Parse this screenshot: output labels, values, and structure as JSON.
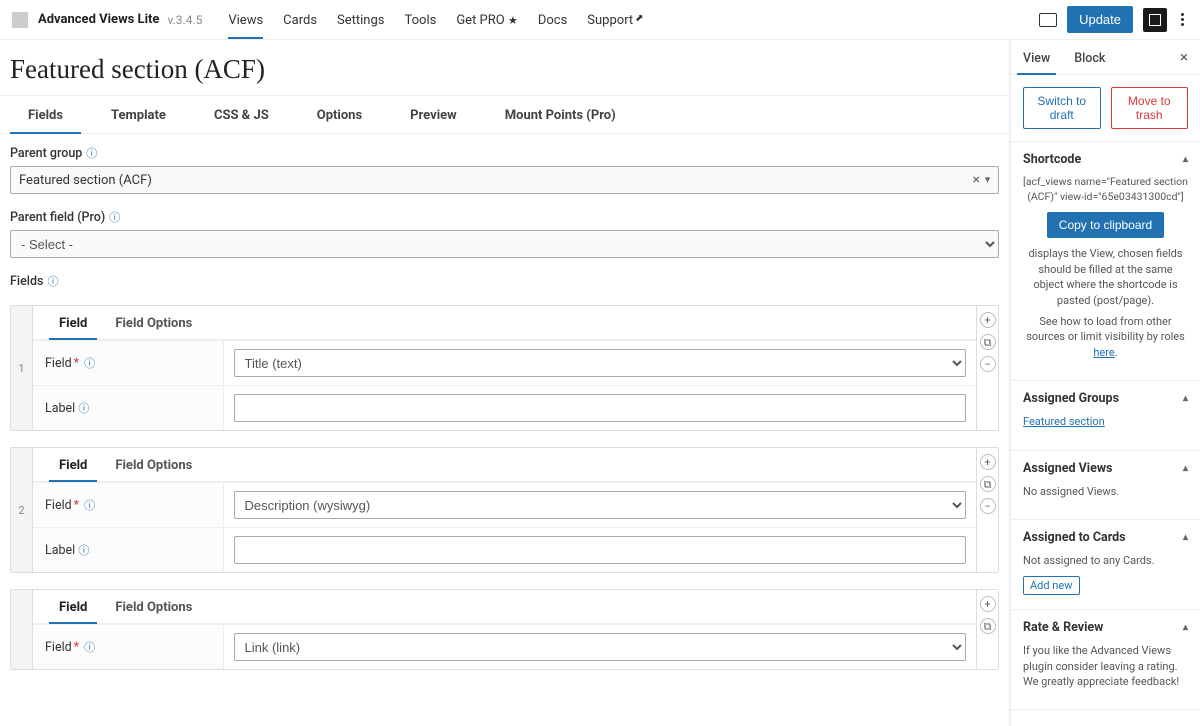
{
  "topbar": {
    "brand": "Advanced Views Lite",
    "version": "v.3.4.5",
    "nav": {
      "views": "Views",
      "cards": "Cards",
      "settings": "Settings",
      "tools": "Tools",
      "getpro": "Get PRO",
      "docs": "Docs",
      "support": "Support"
    },
    "update": "Update"
  },
  "page": {
    "title": "Featured section (ACF)"
  },
  "tabs": {
    "fields": "Fields",
    "template": "Template",
    "cssjs": "CSS & JS",
    "options": "Options",
    "preview": "Preview",
    "mount": "Mount Points (Pro)"
  },
  "pg": {
    "label": "Parent group",
    "value": "Featured section (ACF)"
  },
  "pf": {
    "label": "Parent field (Pro)",
    "value": "- Select -"
  },
  "flds": {
    "label": "Fields"
  },
  "rowtabs": {
    "field": "Field",
    "opts": "Field Options"
  },
  "rowlabels": {
    "field": "Field",
    "label": "Label"
  },
  "rows": {
    "0": {
      "num": "1",
      "field": "Title (text)",
      "label": ""
    },
    "1": {
      "num": "2",
      "field": "Description (wysiwyg)",
      "label": ""
    },
    "2": {
      "num": "",
      "field": "Link (link)",
      "label": ""
    }
  },
  "side": {
    "tab_view": "View",
    "tab_block": "Block",
    "switch_draft": "Switch to draft",
    "trash": "Move to trash",
    "sc": {
      "title": "Shortcode",
      "code": "[acf_views name=\"Featured section (ACF)\" view-id=\"65e03431300cd\"]",
      "copy": "Copy to clipboard",
      "desc": "displays the View, chosen fields should be filled at the same object where the shortcode is pasted (post/page).",
      "see_pre": "See how to load from other sources or limit visibility by roles ",
      "see_link": "here",
      "see_post": "."
    },
    "ag": {
      "title": "Assigned Groups",
      "link": "Featured section"
    },
    "av": {
      "title": "Assigned Views",
      "text": "No assigned Views."
    },
    "ac": {
      "title": "Assigned to Cards",
      "text": "Not assigned to any Cards.",
      "add": "Add new"
    },
    "rr": {
      "title": "Rate & Review",
      "text": "If you like the Advanced Views plugin consider leaving a rating. We greatly appreciate feedback!"
    }
  }
}
